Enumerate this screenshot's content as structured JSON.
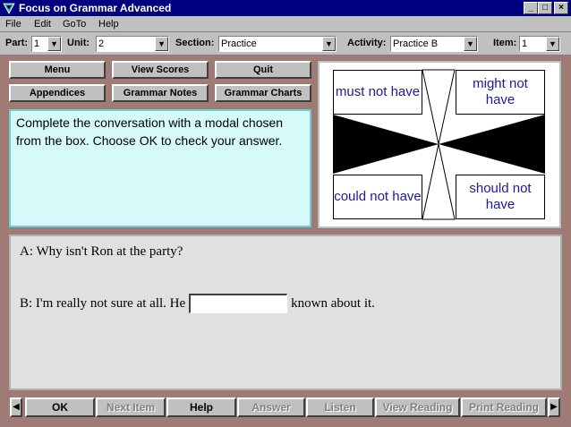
{
  "window": {
    "title": "Focus on Grammar Advanced",
    "controls": {
      "minimize": "_",
      "maximize": "□",
      "close": "×"
    }
  },
  "menu": [
    "File",
    "Edit",
    "GoTo",
    "Help"
  ],
  "toolbar": {
    "part_label": "Part:",
    "part_value": "1",
    "unit_label": "Unit:",
    "unit_value": "2",
    "section_label": "Section:",
    "section_value": "Practice",
    "activity_label": "Activity:",
    "activity_value": "Practice B",
    "item_label": "Item:",
    "item_value": "1",
    "dropdown_glyph": "▼"
  },
  "nav": {
    "menu": "Menu",
    "view_scores": "View Scores",
    "quit": "Quit",
    "appendices": "Appendices",
    "grammar_notes": "Grammar Notes",
    "grammar_charts": "Grammar Charts"
  },
  "instructions": "Complete the conversation with a modal chosen from the box. Choose OK to check your answer.",
  "modal_box": {
    "options": [
      "must not have",
      "might not have",
      "could not have",
      "should not have"
    ]
  },
  "exercise": {
    "line_a": "A:  Why isn't Ron at the party?",
    "line_b_prefix": "B:  I'm really not sure at all. He",
    "answer_value": "",
    "line_b_suffix": "known about it."
  },
  "bottom": {
    "prev_glyph": "◀",
    "next_glyph": "▶",
    "buttons": [
      {
        "label": "OK",
        "enabled": true
      },
      {
        "label": "Next Item",
        "enabled": false
      },
      {
        "label": "Help",
        "enabled": true
      },
      {
        "label": "Answer",
        "enabled": false
      },
      {
        "label": "Listen",
        "enabled": false
      },
      {
        "label": "View Reading",
        "enabled": false
      },
      {
        "label": "Print Reading",
        "enabled": false
      }
    ]
  },
  "colors": {
    "background": "#a07a74",
    "titlebar": "#000080",
    "instructions_bg": "#d6fafa",
    "modal_text": "#1a1aa8"
  }
}
